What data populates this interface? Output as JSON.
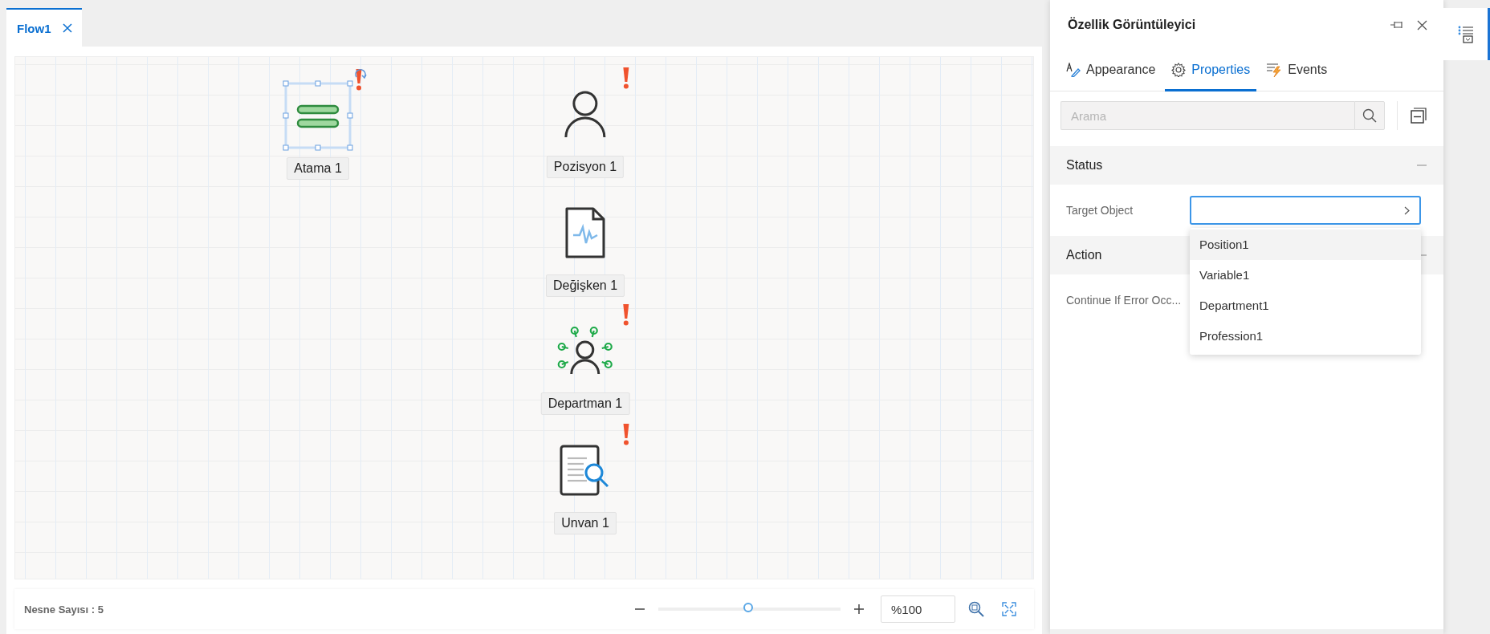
{
  "tabs": [
    {
      "label": "Flow1",
      "selected": true,
      "closable": true
    }
  ],
  "canvas": {
    "nodes": [
      {
        "label": "Atama 1",
        "kind": "assignment",
        "selected": true,
        "warning": true
      },
      {
        "label": "Pozisyon 1",
        "kind": "position",
        "selected": false,
        "warning": true
      },
      {
        "label": "Değişken 1",
        "kind": "variable",
        "selected": false,
        "warning": false
      },
      {
        "label": "Departman 1",
        "kind": "department",
        "selected": false,
        "warning": true
      },
      {
        "label": "Unvan 1",
        "kind": "title",
        "selected": false,
        "warning": true
      }
    ]
  },
  "footer": {
    "object_count": "Nesne Sayısı : 5",
    "zoom_slider": {
      "level": 0.5
    },
    "zoom_value": "%100"
  },
  "panel": {
    "title": "Özellik Görüntüleyici",
    "tabs": [
      {
        "label": "Appearance",
        "kind": "appearance",
        "selected": false
      },
      {
        "label": "Properties",
        "kind": "properties",
        "selected": true
      },
      {
        "label": "Events",
        "kind": "events",
        "selected": false
      }
    ],
    "search": {
      "placeholder": "Arama"
    },
    "sections": [
      {
        "title": "Status",
        "expanded": true,
        "rows": [
          {
            "label": "Target Object",
            "kind": "picker",
            "open": true,
            "options": [
              {
                "label": "Position1",
                "selected": true
              },
              {
                "label": "Variable1",
                "selected": false
              },
              {
                "label": "Department1",
                "selected": false
              },
              {
                "label": "Profession1",
                "selected": false
              }
            ]
          }
        ]
      },
      {
        "title": "Action",
        "expanded": true,
        "rows": [
          {
            "label": "Continue If Error Occ...",
            "kind": "text"
          }
        ]
      }
    ]
  }
}
